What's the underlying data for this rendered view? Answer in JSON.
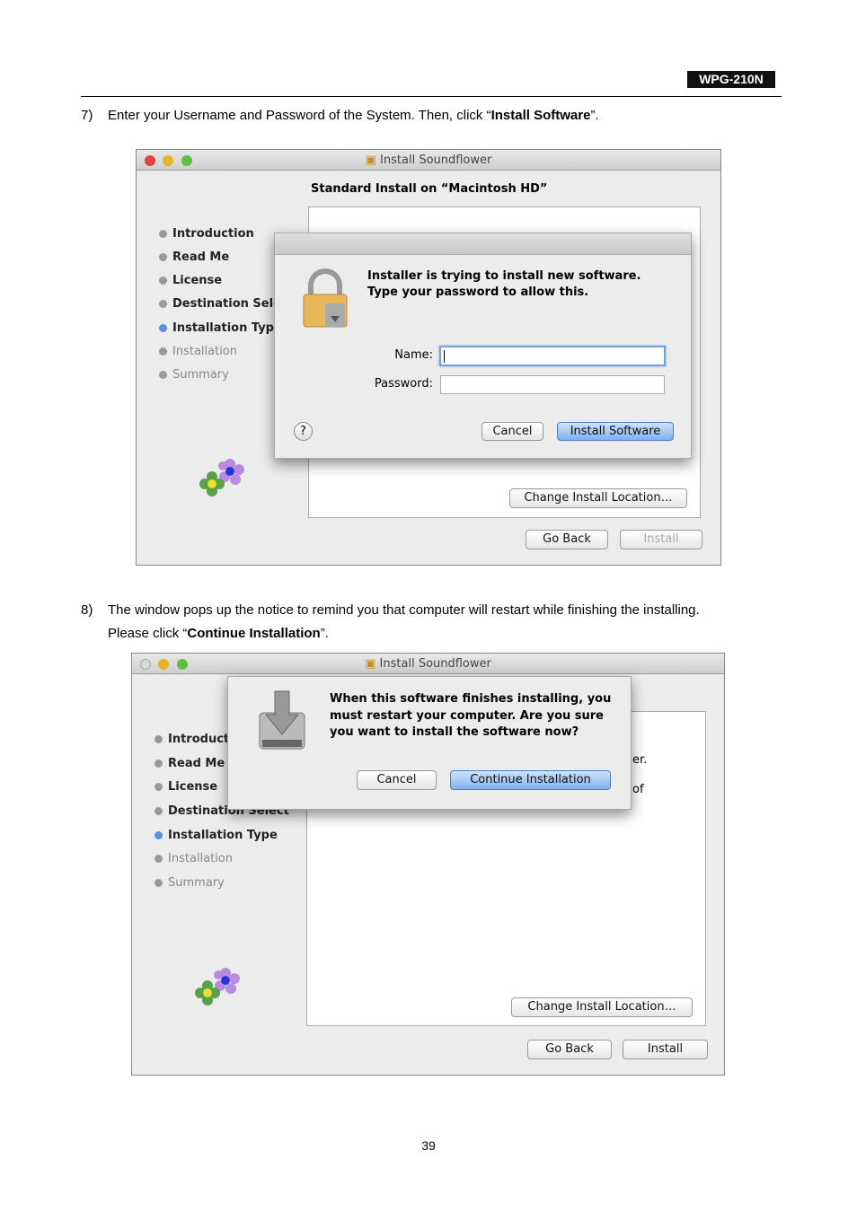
{
  "header": {
    "model": "WPG-210N"
  },
  "step7": {
    "num": "7)",
    "text_before": "Enter your Username and Password of the System. Then, click “",
    "bold": "Install Software",
    "text_after": "”."
  },
  "step8": {
    "num": "8)",
    "line1": "The window pops up the notice to remind you that computer will restart while finishing the installing.",
    "line2_before": "Please click “",
    "bold": "Continue Installation",
    "line2_after": "”."
  },
  "window1": {
    "title": "Install Soundflower",
    "heading": "Standard Install on “Macintosh HD”",
    "sidebar": [
      {
        "label": "Introduction",
        "state": "done"
      },
      {
        "label": "Read Me",
        "state": "done"
      },
      {
        "label": "License",
        "state": "done"
      },
      {
        "label": "Destination Select",
        "state": "done"
      },
      {
        "label": "Installation Type",
        "state": "current"
      },
      {
        "label": "Installation",
        "state": "pending"
      },
      {
        "label": "Summary",
        "state": "pending"
      }
    ],
    "dialog": {
      "message": "Installer is trying to install new software. Type your password to allow this.",
      "name_label": "Name:",
      "name_value": "",
      "password_label": "Password:",
      "password_value": "",
      "help": "?",
      "cancel": "Cancel",
      "install_software": "Install Software"
    },
    "change_location": "Change Install Location…",
    "go_back": "Go Back",
    "install": "Install"
  },
  "window2": {
    "title": "Install Soundflower",
    "sidebar": [
      {
        "label": "Introduction",
        "state": "done"
      },
      {
        "label": "Read Me",
        "state": "done"
      },
      {
        "label": "License",
        "state": "done"
      },
      {
        "label": "Destination Select",
        "state": "done"
      },
      {
        "label": "Installation Type",
        "state": "current"
      },
      {
        "label": "Installation",
        "state": "pending"
      },
      {
        "label": "Summary",
        "state": "pending"
      }
    ],
    "behind_text_1": "er.",
    "behind_text_2": "of",
    "dialog": {
      "message": "When this software finishes installing, you must restart your computer. Are you sure you want to install the software now?",
      "cancel": "Cancel",
      "continue": "Continue Installation"
    },
    "change_location": "Change Install Location…",
    "go_back": "Go Back",
    "install": "Install"
  },
  "footer": {
    "page_number": "39"
  },
  "colors": {
    "accent": "#5b8fe0",
    "close": "#e0443e",
    "minimize": "#e8b32a",
    "zoom": "#5cbf3e"
  }
}
